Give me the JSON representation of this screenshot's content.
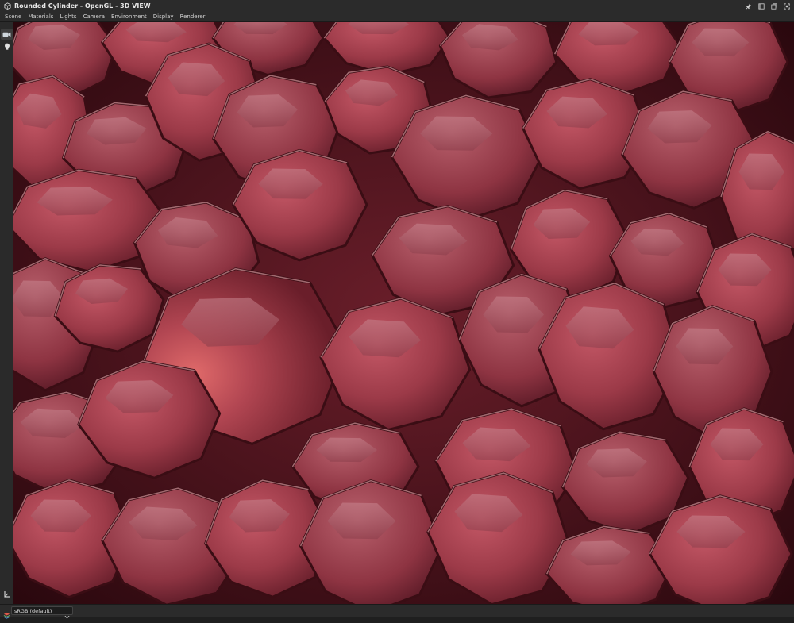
{
  "window": {
    "title": "Rounded Cylinder - OpenGL - 3D VIEW"
  },
  "menu": {
    "items": [
      "Scene",
      "Materials",
      "Lights",
      "Camera",
      "Environment",
      "Display",
      "Renderer"
    ]
  },
  "toolstrip": {
    "tools": [
      "camera-icon",
      "light-bulb-icon"
    ]
  },
  "viewport": {
    "base_color": "#a8404f",
    "highlight_color": "#d87a82",
    "shadow_color": "#3a0d14"
  },
  "statusbar": {
    "color_space": "sRGB (default)"
  },
  "colors": {
    "titlebar_bg": "#2b2b2b",
    "accent_camera": "#4a9fe0",
    "accent_light": "#e8c86a"
  }
}
